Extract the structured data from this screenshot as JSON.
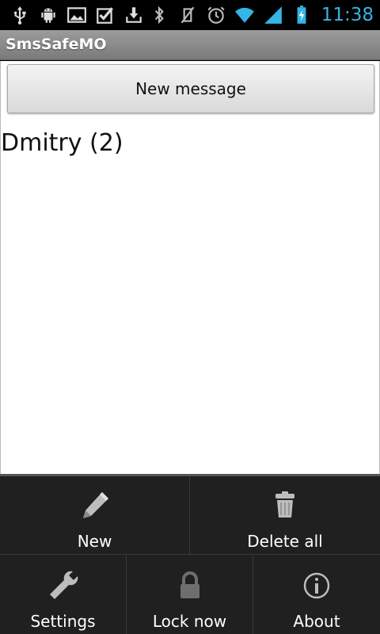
{
  "status_bar": {
    "time": "11:38",
    "accent_color": "#33b5e5",
    "left_icons": [
      "usb-icon",
      "android-debug-icon",
      "image-icon",
      "checkbox-icon",
      "download-icon"
    ],
    "right_icons": [
      "bluetooth-icon",
      "vibrate-off-icon",
      "alarm-icon",
      "wifi-icon",
      "signal-icon",
      "battery-charging-icon"
    ]
  },
  "app": {
    "title": "SmsSafeMO"
  },
  "main": {
    "new_message_label": "New message",
    "conversations": [
      {
        "label": "Dmitry (2)"
      }
    ]
  },
  "menu": {
    "row1": [
      {
        "label": "New",
        "icon": "pencil-icon"
      },
      {
        "label": "Delete all",
        "icon": "trash-icon"
      }
    ],
    "row2": [
      {
        "label": "Settings",
        "icon": "wrench-icon"
      },
      {
        "label": "Lock now",
        "icon": "lock-icon"
      },
      {
        "label": "About",
        "icon": "info-icon"
      }
    ]
  }
}
